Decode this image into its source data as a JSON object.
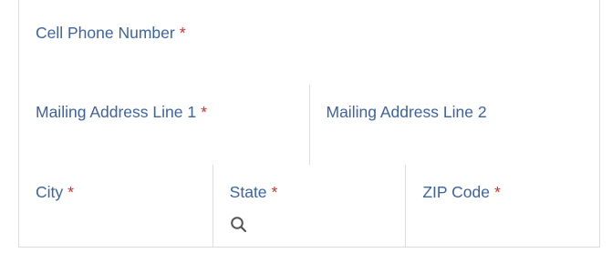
{
  "form": {
    "fields": {
      "cell_phone": {
        "label": "Cell Phone Number",
        "required_mark": "*"
      },
      "address_line1": {
        "label": "Mailing Address Line 1",
        "required_mark": "*"
      },
      "address_line2": {
        "label": "Mailing Address Line 2"
      },
      "city": {
        "label": "City",
        "required_mark": "*"
      },
      "state": {
        "label": "State",
        "required_mark": "*",
        "icon": "search-icon"
      },
      "zip": {
        "label": "ZIP Code",
        "required_mark": "*"
      }
    }
  },
  "colors": {
    "label": "#3b63a0",
    "required": "#cc3333",
    "border": "#dcdcdc",
    "icon": "#555555"
  }
}
